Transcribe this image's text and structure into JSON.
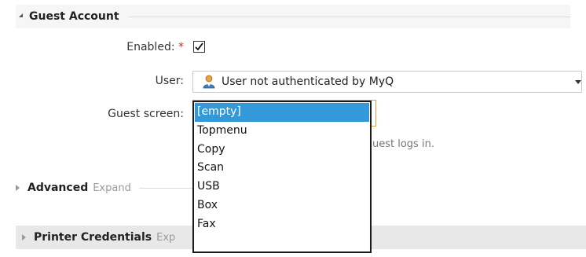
{
  "section": {
    "title": "Guest Account"
  },
  "fields": {
    "enabled_label": "Enabled:",
    "required_marker": "*",
    "enabled_checked": true,
    "user_label": "User:",
    "user_value": "User not authenticated by MyQ",
    "user_icon": "user-icon",
    "guest_screen_label": "Guest screen:",
    "guest_screen_hint": "uest logs in."
  },
  "dropdown": {
    "options": [
      "[empty]",
      "Topmenu",
      "Copy",
      "Scan",
      "USB",
      "Box",
      "Fax"
    ],
    "selected_index": 0
  },
  "advanced": {
    "title": "Advanced",
    "expand_label": "Expand"
  },
  "printer_credentials": {
    "title": "Printer Credentials",
    "expand_label": "Exp"
  },
  "colors": {
    "selection": "#3399d8",
    "required": "#d62828",
    "focus": "#d9a441"
  }
}
